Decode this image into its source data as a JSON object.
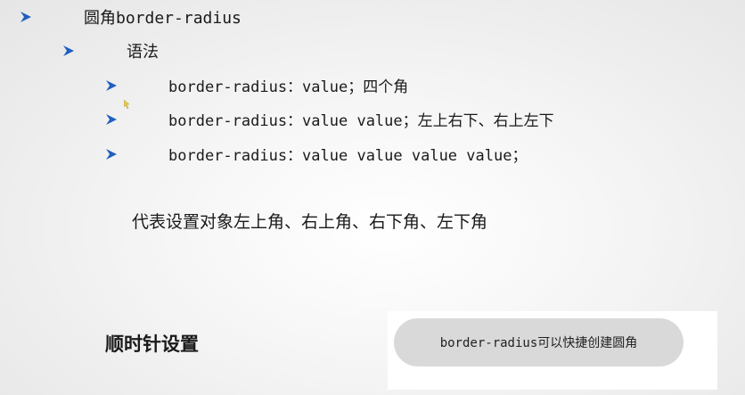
{
  "slide": {
    "title": "圆角border-radius",
    "subtitle": "语法",
    "syntax_lines": [
      "border-radius：value；四个角",
      "border-radius：value value；左上右下、右上左下",
      "border-radius：value value value value；"
    ],
    "description": "代表设置对象左上角、右上角、右下角、左下角",
    "clockwise_label": "顺时针设置",
    "demo_text": "border-radius可以快捷创建圆角"
  },
  "colors": {
    "bullet": "#1f5fbf",
    "demo_fill": "#d9d9d9"
  },
  "icons": {
    "bullet": "arrow-bullet-icon"
  }
}
